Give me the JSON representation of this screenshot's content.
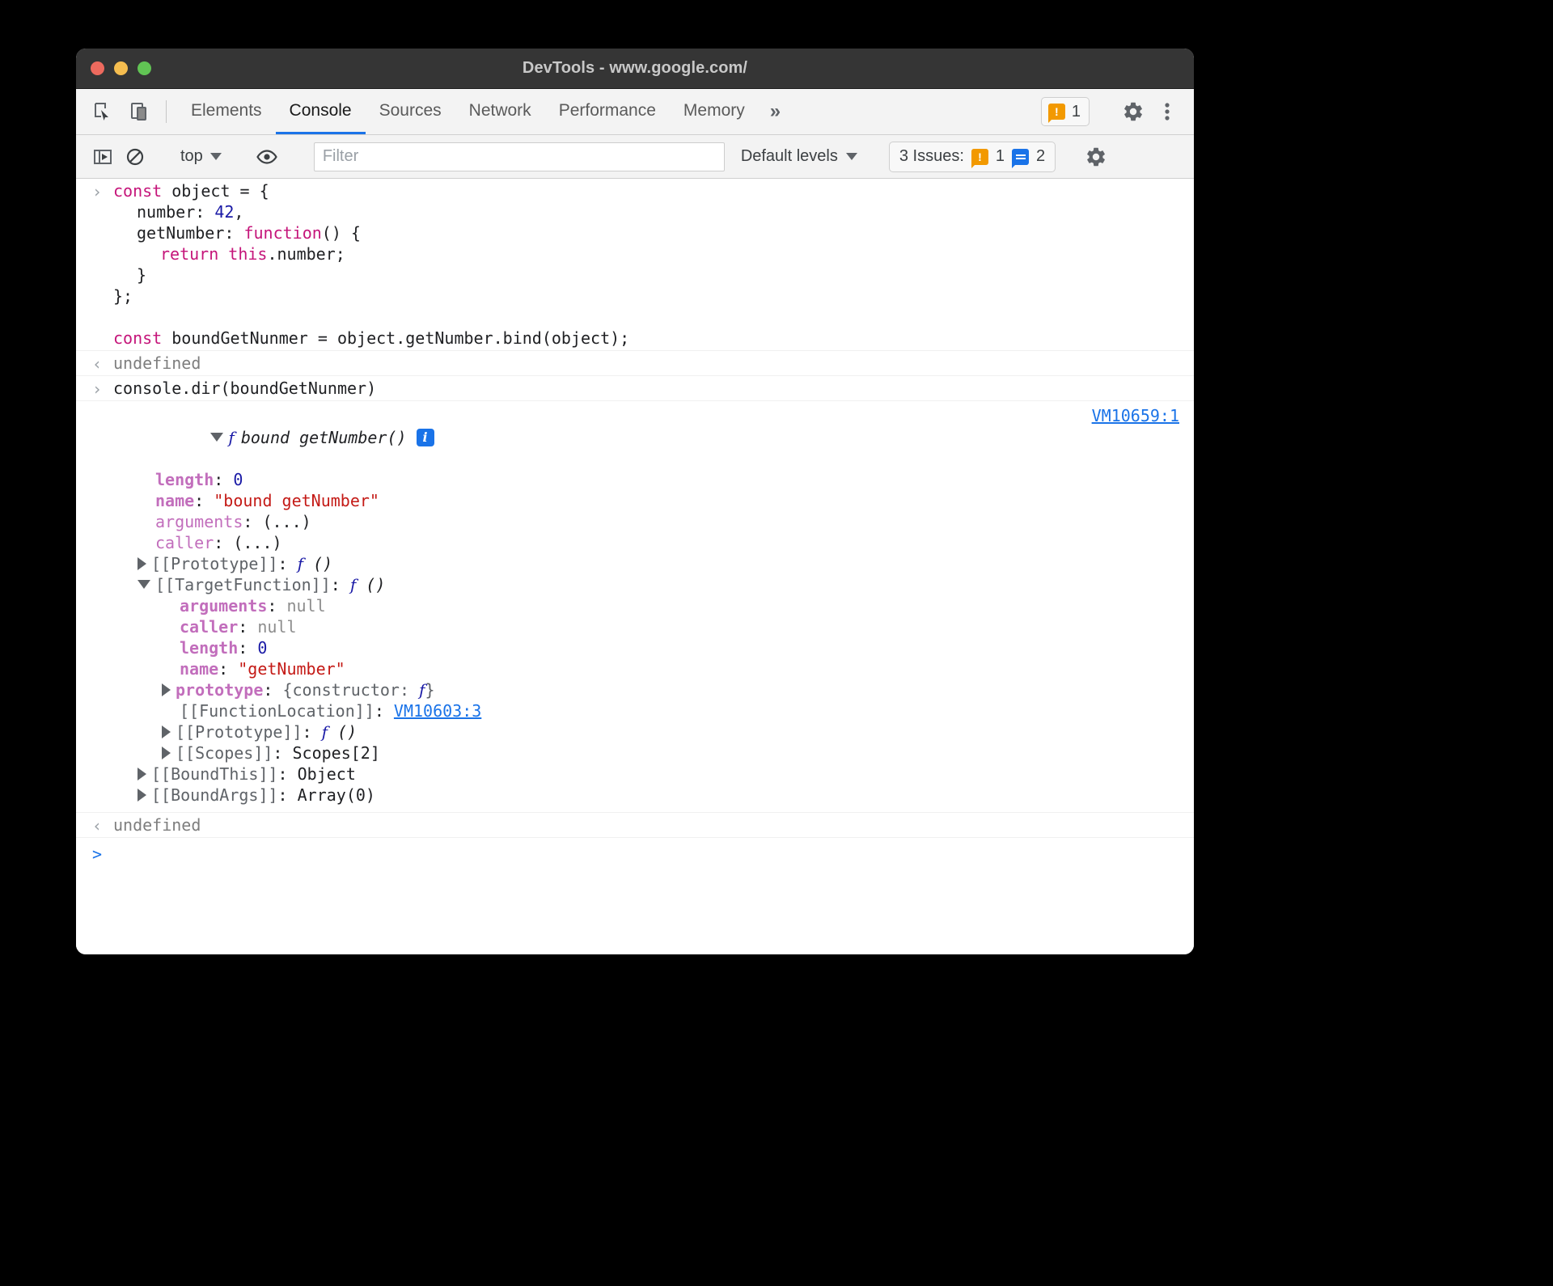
{
  "window": {
    "title": "DevTools - www.google.com/",
    "traffic_lights": [
      "close-button",
      "minimize-button",
      "maximize-button"
    ]
  },
  "tabbar": {
    "left_icons": [
      "inspect-element-icon",
      "device-toolbar-icon"
    ],
    "tabs": [
      {
        "label": "Elements",
        "active": false
      },
      {
        "label": "Console",
        "active": true
      },
      {
        "label": "Sources",
        "active": false
      },
      {
        "label": "Network",
        "active": false
      },
      {
        "label": "Performance",
        "active": false
      },
      {
        "label": "Memory",
        "active": false
      }
    ],
    "more_tabs": "»",
    "warning_badge": {
      "icon": "warning-icon",
      "count": "1",
      "color": "#f29900"
    },
    "settings_icon": "gear-icon",
    "menu_icon": "kebab-menu-icon"
  },
  "console_toolbar": {
    "sidebar_toggle_icon": "console-sidebar-icon",
    "clear_icon": "clear-console-icon",
    "context": "top",
    "eye_icon": "live-expression-icon",
    "filter": {
      "value": "",
      "placeholder": "Filter"
    },
    "levels": "Default levels",
    "issues": {
      "label": "3 Issues:",
      "warning_count": "1",
      "info_count": "2",
      "warning_color": "#f29900",
      "info_color": "#1a73e8"
    },
    "settings_icon": "gear-icon"
  },
  "console": {
    "input_lines": [
      {
        "indent": 0,
        "tokens": [
          {
            "t": "const",
            "c": "kw"
          },
          {
            "t": " object = {",
            "c": "plain"
          }
        ]
      },
      {
        "indent": 1,
        "tokens": [
          {
            "t": "number: ",
            "c": "plain"
          },
          {
            "t": "42",
            "c": "num"
          },
          {
            "t": ",",
            "c": "plain"
          }
        ]
      },
      {
        "indent": 1,
        "tokens": [
          {
            "t": "getNumber: ",
            "c": "plain"
          },
          {
            "t": "function",
            "c": "kw"
          },
          {
            "t": "() {",
            "c": "plain"
          }
        ]
      },
      {
        "indent": 2,
        "tokens": [
          {
            "t": "return",
            "c": "kw"
          },
          {
            "t": " ",
            "c": "plain"
          },
          {
            "t": "this",
            "c": "kw"
          },
          {
            "t": ".number;",
            "c": "plain"
          }
        ]
      },
      {
        "indent": 1,
        "tokens": [
          {
            "t": "}",
            "c": "plain"
          }
        ]
      },
      {
        "indent": 0,
        "tokens": [
          {
            "t": "};",
            "c": "plain"
          }
        ]
      },
      {
        "indent": 0,
        "tokens": [
          {
            "t": "",
            "c": "plain"
          }
        ]
      },
      {
        "indent": 0,
        "tokens": [
          {
            "t": "const",
            "c": "kw"
          },
          {
            "t": " boundGetNunmer = object.getNumber.bind(object);",
            "c": "plain"
          }
        ]
      }
    ],
    "result_undefined_1": "undefined",
    "command_2": "console.dir(boundGetNunmer)",
    "object_header": {
      "glyph": "f",
      "label": "bound getNumber()",
      "info_badge": "i",
      "source_link": "VM10659:1"
    },
    "props": [
      {
        "indent": 1,
        "arrow": "none",
        "key": "length",
        "key_class": "prop-own",
        "sep": ": ",
        "value": "0",
        "value_class": "num"
      },
      {
        "indent": 1,
        "arrow": "none",
        "key": "name",
        "key_class": "prop-own",
        "sep": ": ",
        "value": "\"bound getNumber\"",
        "value_class": "str"
      },
      {
        "indent": 1,
        "arrow": "none",
        "key": "arguments",
        "key_class": "prop",
        "sep": ": ",
        "value": "(...)",
        "value_class": "plain"
      },
      {
        "indent": 1,
        "arrow": "none",
        "key": "caller",
        "key_class": "prop",
        "sep": ": ",
        "value": "(...)",
        "value_class": "plain"
      },
      {
        "indent": 1,
        "arrow": "closed",
        "key": "[[Prototype]]",
        "key_class": "internal",
        "sep": ": ",
        "value": "f ()",
        "value_class": "fn"
      },
      {
        "indent": 1,
        "arrow": "open",
        "key": "[[TargetFunction]]",
        "key_class": "internal",
        "sep": ": ",
        "value": "f ()",
        "value_class": "fn"
      },
      {
        "indent": 2,
        "arrow": "none",
        "key": "arguments",
        "key_class": "prop-own",
        "sep": ": ",
        "value": "null",
        "value_class": "nullv"
      },
      {
        "indent": 2,
        "arrow": "none",
        "key": "caller",
        "key_class": "prop-own",
        "sep": ": ",
        "value": "null",
        "value_class": "nullv"
      },
      {
        "indent": 2,
        "arrow": "none",
        "key": "length",
        "key_class": "prop-own",
        "sep": ": ",
        "value": "0",
        "value_class": "num"
      },
      {
        "indent": 2,
        "arrow": "none",
        "key": "name",
        "key_class": "prop-own",
        "sep": ": ",
        "value": "\"getNumber\"",
        "value_class": "str"
      },
      {
        "indent": 2,
        "arrow": "closed",
        "key": "prototype",
        "key_class": "prop-own",
        "sep": ": ",
        "value": "{constructor: f}",
        "value_class": "ctor"
      },
      {
        "indent": 2,
        "arrow": "none",
        "key": "[[FunctionLocation]]",
        "key_class": "internal",
        "sep": ": ",
        "value": "VM10603:3",
        "value_class": "link"
      },
      {
        "indent": 2,
        "arrow": "closed",
        "key": "[[Prototype]]",
        "key_class": "internal",
        "sep": ": ",
        "value": "f ()",
        "value_class": "fn"
      },
      {
        "indent": 2,
        "arrow": "closed",
        "key": "[[Scopes]]",
        "key_class": "internal",
        "sep": ": ",
        "value": "Scopes[2]",
        "value_class": "plain"
      },
      {
        "indent": 1,
        "arrow": "closed",
        "key": "[[BoundThis]]",
        "key_class": "internal",
        "sep": ": ",
        "value": "Object",
        "value_class": "plain"
      },
      {
        "indent": 1,
        "arrow": "closed",
        "key": "[[BoundArgs]]",
        "key_class": "internal",
        "sep": ": ",
        "value": "Array(0)",
        "value_class": "plain"
      }
    ],
    "result_undefined_2": "undefined",
    "prompt_caret": ">",
    "input_caret": "›",
    "output_caret": "‹"
  }
}
